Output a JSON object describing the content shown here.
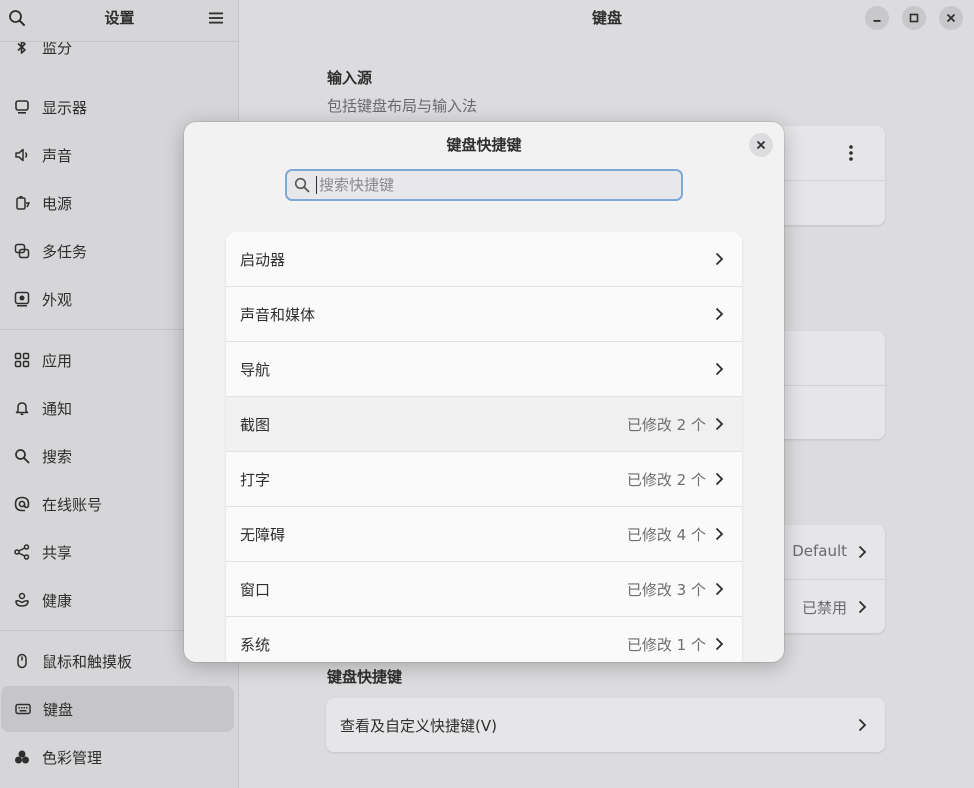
{
  "sidebar": {
    "title": "设置",
    "items": [
      {
        "label": "监分",
        "icon": "bluetooth-icon"
      },
      {
        "label": "显示器",
        "icon": "display-icon"
      },
      {
        "label": "声音",
        "icon": "speaker-icon"
      },
      {
        "label": "电源",
        "icon": "battery-icon"
      },
      {
        "label": "多任务",
        "icon": "multitasking-icon"
      },
      {
        "label": "外观",
        "icon": "appearance-icon"
      },
      {
        "label": "应用",
        "icon": "apps-grid-icon"
      },
      {
        "label": "通知",
        "icon": "bell-icon"
      },
      {
        "label": "搜索",
        "icon": "search-icon"
      },
      {
        "label": "在线账号",
        "icon": "at-sign-icon"
      },
      {
        "label": "共享",
        "icon": "share-icon"
      },
      {
        "label": "健康",
        "icon": "wellbeing-icon"
      },
      {
        "label": "鼠标和触摸板",
        "icon": "mouse-icon"
      },
      {
        "label": "键盘",
        "icon": "keyboard-icon"
      },
      {
        "label": "色彩管理",
        "icon": "color-icon"
      }
    ],
    "active_index": 13
  },
  "window": {
    "title": "键盘"
  },
  "main": {
    "input_sources_title": "输入源",
    "input_sources_subtitle": "包括键盘布局与输入法",
    "row_default_value": "Default",
    "row_disabled_value": "已禁用",
    "shortcuts_title": "键盘快捷键",
    "shortcuts_row_label": "查看及自定义快捷键(V)"
  },
  "dialog": {
    "title": "键盘快捷键",
    "search_placeholder": "搜索快捷键",
    "categories": [
      {
        "label": "启动器",
        "value": ""
      },
      {
        "label": "声音和媒体",
        "value": ""
      },
      {
        "label": "导航",
        "value": ""
      },
      {
        "label": "截图",
        "value": "已修改 2 个"
      },
      {
        "label": "打字",
        "value": "已修改 2 个"
      },
      {
        "label": "无障碍",
        "value": "已修改 4 个"
      },
      {
        "label": "窗口",
        "value": "已修改 3 个"
      },
      {
        "label": "系统",
        "value": "已修改 1 个"
      }
    ]
  },
  "colors": {
    "accent": "#7fa9d6"
  }
}
